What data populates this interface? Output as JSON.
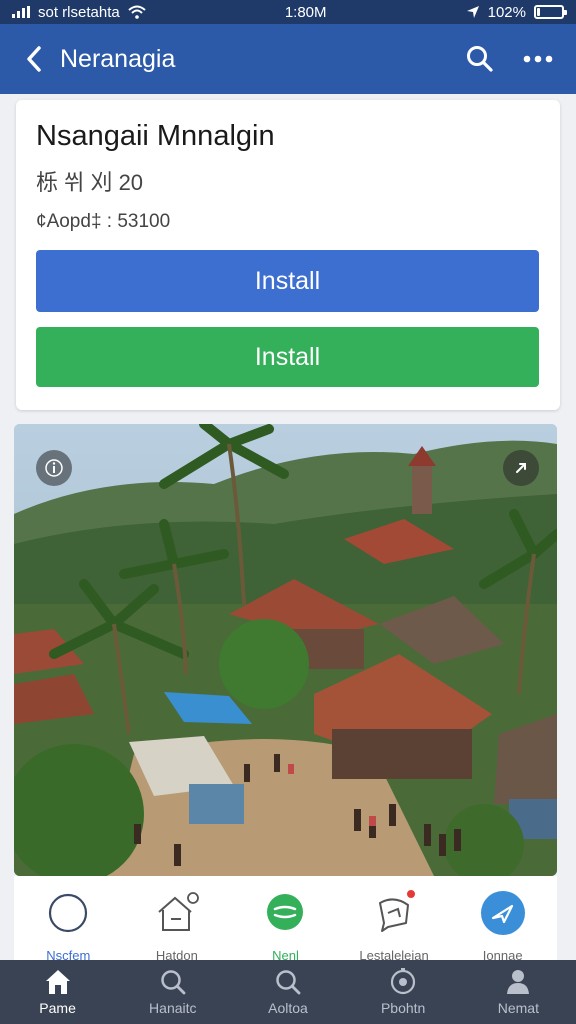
{
  "status_bar": {
    "carrier": "sot rlsetahta",
    "time": "1:80M",
    "battery": "102%"
  },
  "app_bar": {
    "title": "Neranagia",
    "back_icon": "chevron-left-icon",
    "search_icon": "search-icon",
    "more_icon": "more-horizontal-icon"
  },
  "app_card": {
    "name": "Nsangaii Mnnalgin",
    "subtitle": "栎 쒸 刈 20",
    "meta": "¢Aopd‡ : 53100",
    "primary_button": "Install",
    "secondary_button": "Install",
    "primary_color": "#3d6fd1",
    "secondary_color": "#34b05a"
  },
  "photo": {
    "description_icon_left": "info-icon",
    "description_icon_right": "expand-icon"
  },
  "shortcuts": [
    {
      "label": "Nscfem",
      "icon": "circle-icon"
    },
    {
      "label": "Hatdon",
      "icon": "house-icon"
    },
    {
      "label": "Nenl",
      "icon": "chat-bubble-icon"
    },
    {
      "label": "Lestaleleian",
      "icon": "message-icon"
    },
    {
      "label": "Ionnae",
      "icon": "send-icon"
    }
  ],
  "bottom_nav": [
    {
      "label": "Pame",
      "icon": "home-icon"
    },
    {
      "label": "Hanaitc",
      "icon": "search-icon"
    },
    {
      "label": "Aoltoa",
      "icon": "search-icon"
    },
    {
      "label": "Pbohtn",
      "icon": "photo-icon"
    },
    {
      "label": "Nemat",
      "icon": "person-icon"
    }
  ]
}
